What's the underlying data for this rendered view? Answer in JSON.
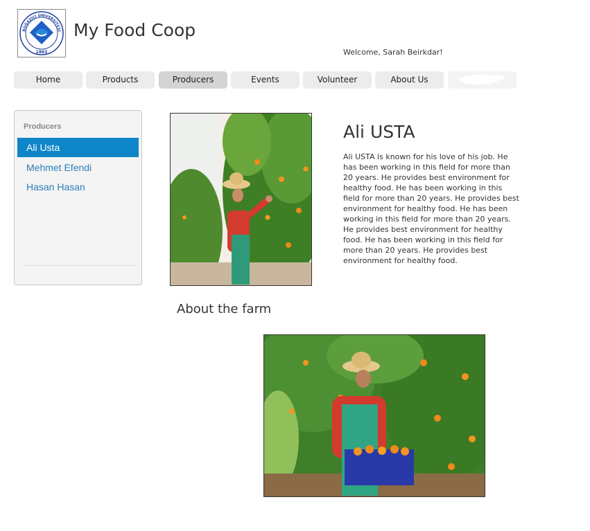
{
  "header": {
    "logo": {
      "text_top": "BOĞAZİÇİ ÜNİVERSİTESİ",
      "year": "1863",
      "icon": "university-seal"
    },
    "site_title": "My Food Coop",
    "welcome": "Welcome, Sarah Beirkdar!"
  },
  "nav": {
    "items": [
      {
        "label": "Home"
      },
      {
        "label": "Products"
      },
      {
        "label": "Producers",
        "active": true
      },
      {
        "label": "Events"
      },
      {
        "label": "Volunteer"
      },
      {
        "label": "About Us"
      }
    ]
  },
  "sidebar": {
    "title": "Producers",
    "items": [
      {
        "label": "Ali Usta",
        "active": true
      },
      {
        "label": "Mehmet Efendi"
      },
      {
        "label": "Hasan Hasan"
      }
    ]
  },
  "producer": {
    "name": "Ali USTA",
    "bio": "Ali USTA is known for his love of his job. He has been working in this field for more than 20 years. He provides best environment for healthy food.  He has been working in this field for more than 20 years. He provides best environment for healthy food.  He has been working in this field for more than 20 years. He provides best environment for healthy food.  He has been working in this field for more than 20 years. He provides best environment for healthy food.",
    "photo_icon": "farmer-picking-oranges-photo"
  },
  "farm": {
    "heading": "About the farm",
    "photo_icon": "farmer-with-orange-crate-photo"
  },
  "colors": {
    "accent": "#0f86c8",
    "link": "#2a7fb8",
    "nav_bg": "#ececec",
    "nav_active": "#d4d4d4",
    "sidebar_bg": "#f4f4f4"
  }
}
